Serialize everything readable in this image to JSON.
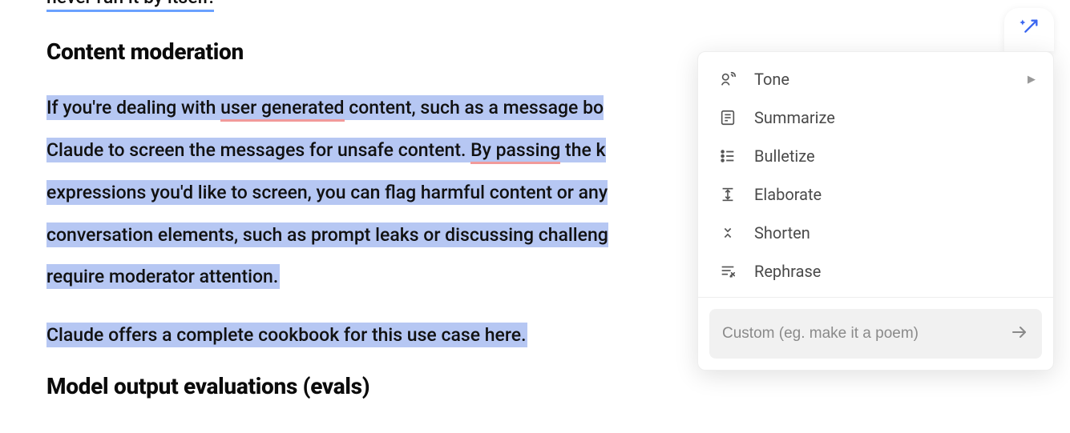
{
  "doc": {
    "fragment_top": "never run it by itself.",
    "section1_title": "Content moderation",
    "para1": {
      "t1": "If you're dealing with ",
      "u1": "user generated",
      "t2": " content, such as a message bo",
      "t3": "Claude to screen the messages for unsafe content. ",
      "u2": "By passing",
      "t4": " the k",
      "t5": "expressions you'd like to screen, you can flag harmful content or any",
      "t6": "conversation elements, such as prompt leaks or discussing challeng",
      "t7": "require moderator attention."
    },
    "para2": "Claude offers a complete cookbook for this use case here.",
    "section2_title": "Model output evaluations (evals)"
  },
  "menu": {
    "items": [
      {
        "label": "Tone",
        "has_submenu": true
      },
      {
        "label": "Summarize",
        "has_submenu": false
      },
      {
        "label": "Bulletize",
        "has_submenu": false
      },
      {
        "label": "Elaborate",
        "has_submenu": false
      },
      {
        "label": "Shorten",
        "has_submenu": false
      },
      {
        "label": "Rephrase",
        "has_submenu": false
      }
    ],
    "custom_placeholder": "Custom (eg. make it a poem)"
  }
}
